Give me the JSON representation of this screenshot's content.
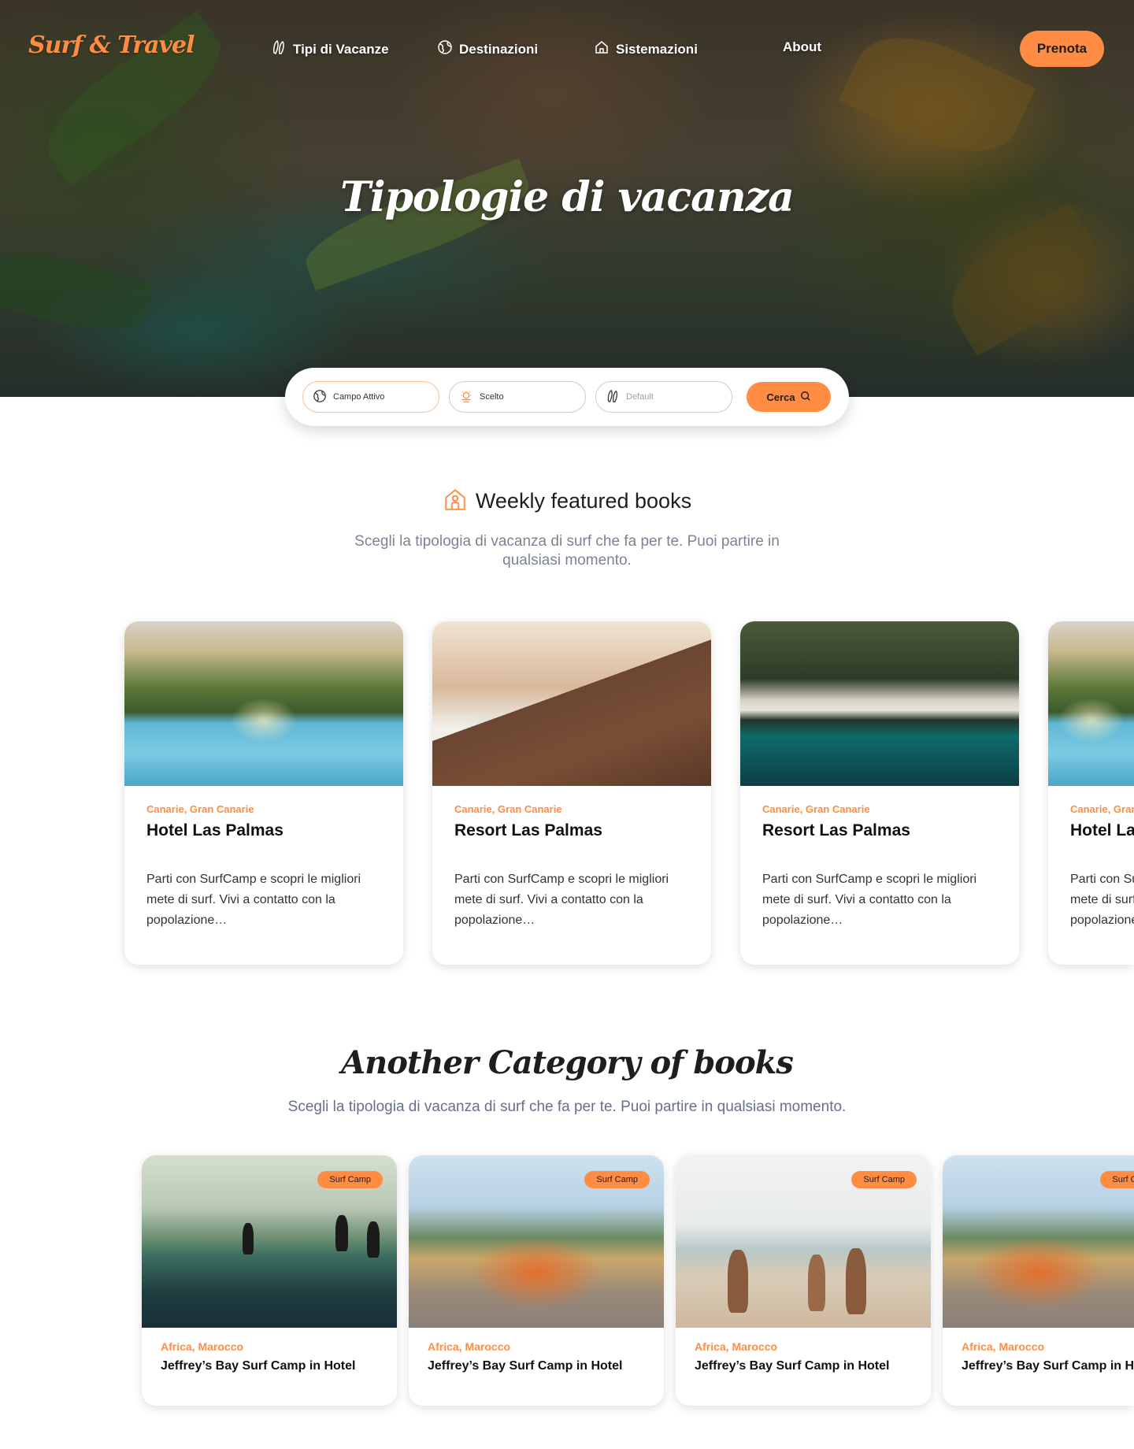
{
  "brand": {
    "logo": "Surf & Travel",
    "accent": "#ff8c42"
  },
  "nav": {
    "items": [
      {
        "label": "Tipi di Vacanze",
        "icon": "surfboard-icon"
      },
      {
        "label": "Destinazioni",
        "icon": "globe-icon"
      },
      {
        "label": "Sistemazioni",
        "icon": "home-icon"
      },
      {
        "label": "About",
        "icon": ""
      }
    ],
    "cta": "Prenota"
  },
  "hero": {
    "title": "Tipologie di vacanza"
  },
  "search": {
    "fields": [
      {
        "value": "Campo Attivo",
        "placeholder": "",
        "icon": "globe-icon"
      },
      {
        "value": "Scelto",
        "placeholder": "",
        "icon": "sun-icon"
      },
      {
        "value": "",
        "placeholder": "Default",
        "icon": "surfboard-icon"
      }
    ],
    "button": "Cerca"
  },
  "featured": {
    "title": "Weekly featured books",
    "subtitle": "Scegli la tipologia di vacanza di surf che fa per te. Puoi partire in qualsiasi momento.",
    "cards": [
      {
        "location": "Canarie, Gran Canarie",
        "name": "Hotel Las Palmas",
        "description": "Parti con SurfCamp e scopri le migliori mete di surf. Vivi a contatto con la popolazione…"
      },
      {
        "location": "Canarie, Gran Canarie",
        "name": "Resort Las Palmas",
        "description": "Parti con SurfCamp e scopri le migliori mete di surf. Vivi a contatto con la popolazione…"
      },
      {
        "location": "Canarie, Gran Canarie",
        "name": "Resort Las Palmas",
        "description": "Parti con SurfCamp e scopri le migliori mete di surf. Vivi a contatto con la popolazione…"
      },
      {
        "location": "Canarie, Gran Canarie",
        "name": "Hotel Las Palmas",
        "description": "Parti con SurfCamp e scopri le migliori mete di surf. Vivi a contatto con la popolazione…"
      }
    ]
  },
  "category": {
    "title": "Another Category of books",
    "subtitle": "Scegli la tipologia di vacanza di surf che fa per te. Puoi partire in qualsiasi momento.",
    "cards": [
      {
        "badge": "Surf Camp",
        "location": "Africa, Marocco",
        "name": "Jeffrey’s Bay Surf Camp in Hotel"
      },
      {
        "badge": "Surf Camp",
        "location": "Africa, Marocco",
        "name": "Jeffrey’s Bay Surf Camp in Hotel"
      },
      {
        "badge": "Surf Camp",
        "location": "Africa, Marocco",
        "name": "Jeffrey’s Bay Surf Camp in Hotel"
      },
      {
        "badge": "Surf Camp",
        "location": "Africa, Marocco",
        "name": "Jeffrey’s Bay Surf Camp in Hotel"
      }
    ]
  }
}
